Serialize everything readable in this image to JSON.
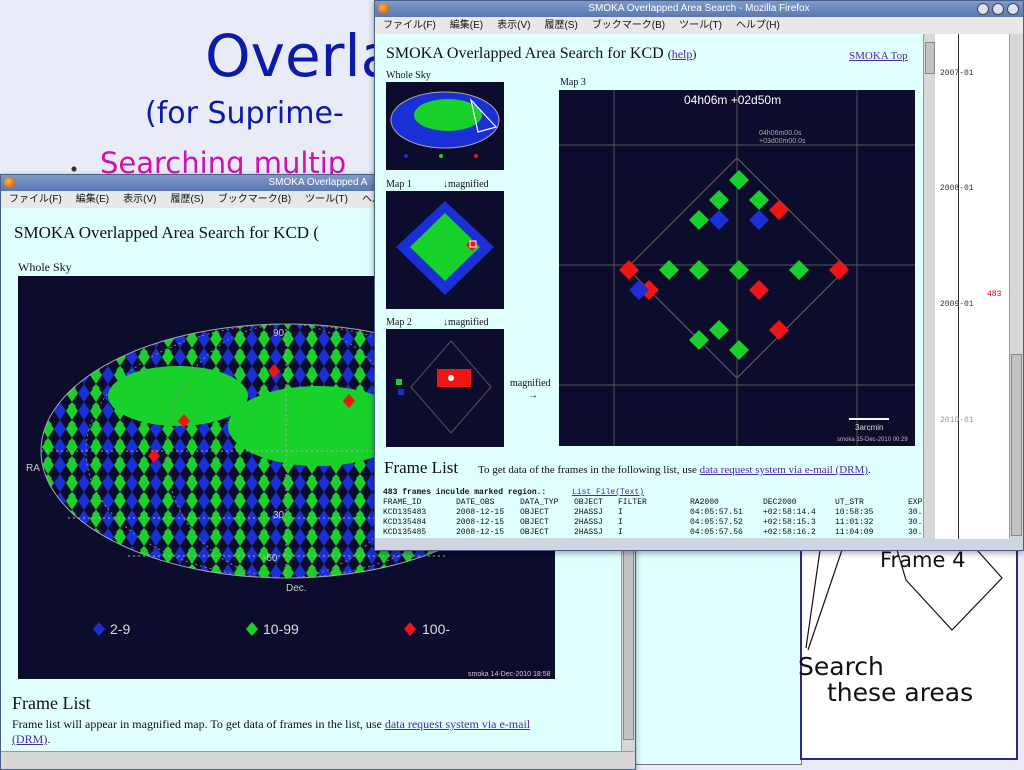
{
  "slide": {
    "title": "Overla",
    "subtitle": "(for Suprime-",
    "bullet_marker": "・",
    "bullet": "Searching multip"
  },
  "diagram": {
    "frame_label": "Frame 4",
    "search_line1": "Search",
    "search_line2": "these areas"
  },
  "back_window": {
    "title": "SMOKA Overlapped A",
    "menu": [
      "ファイル(F)",
      "編集(E)",
      "表示(V)",
      "履歴(S)",
      "ブックマーク(B)",
      "ツール(T)",
      "ヘルプ"
    ],
    "page_title": "SMOKA Overlapped Area Search for KCD (",
    "whole_sky_label": "Whole Sky",
    "axis_labels": [
      "90",
      "RA",
      "30",
      "-60",
      "Dec."
    ],
    "legend": [
      {
        "label": "2-9",
        "color": "#1a2fd6"
      },
      {
        "label": "10-99",
        "color": "#18d12a"
      },
      {
        "label": "100-",
        "color": "#f01414"
      }
    ],
    "credit": "smoka 14-Dec-2010 18:58",
    "frame_list_heading": "Frame List",
    "frame_list_text": "Frame list will appear in magnified map. To get data of frames in the list, use ",
    "drm_link": "data request system via e-mail",
    "drm_link2": "(DRM)",
    "period": "."
  },
  "front_window": {
    "title": "SMOKA Overlapped Area Search - Mozilla Firefox",
    "menu": [
      "ファイル(F)",
      "編集(E)",
      "表示(V)",
      "履歴(S)",
      "ブックマーク(B)",
      "ツール(T)",
      "ヘルプ(H)"
    ],
    "page_title": "SMOKA Overlapped Area Search for KCD",
    "help_link": "help",
    "top_link": "SMOKA Top",
    "whole_sky_label": "Whole Sky",
    "map1_label": "Map 1",
    "map2_label": "Map 2",
    "map3_label": "Map 3",
    "magnified_down": "↓magnified",
    "magnified_right": "magnified",
    "arrow_right": "→",
    "map3_coords": "04h06m +02d50m",
    "map3_small_coords": [
      "04h06m00.0s",
      "+03d00m00.0s"
    ],
    "scale_label": "3arcmin",
    "credit": "smoka 15-Dec-2010 00:29",
    "frame_list_heading": "Frame List",
    "frame_list_text": "To get data of the frames in the following list, use ",
    "drm_link": "data request system via e-mail (DRM)",
    "frames_count_text": "483 frames inculde marked region.:",
    "list_file_link": "List File(Text)",
    "columns": [
      "FRAME_ID",
      "DATE_OBS",
      "DATA_TYP",
      "OBJECT",
      "FILTER",
      "RA2000",
      "DEC2000",
      "UT_STR",
      "EXP"
    ],
    "rows": [
      [
        "KCD135483",
        "2008-12-15",
        "OBJECT",
        "2HASSJ",
        "I",
        "04:05:57.51",
        "+02:58:14.4",
        "10:58:35",
        "30."
      ],
      [
        "KCD135484",
        "2008-12-15",
        "OBJECT",
        "2HASSJ",
        "I",
        "04:05:57.52",
        "+02:58:15.3",
        "11:01:32",
        "30."
      ],
      [
        "KCD135485",
        "2008-12-15",
        "OBJECT",
        "2HASSJ",
        "I",
        "04:05:57.56",
        "+02:58:16.2",
        "11:04:09",
        "30."
      ]
    ]
  },
  "timeline": {
    "labels": [
      "2007-01",
      "2008-01",
      "2009-01",
      "2010-01"
    ],
    "count": "483"
  }
}
